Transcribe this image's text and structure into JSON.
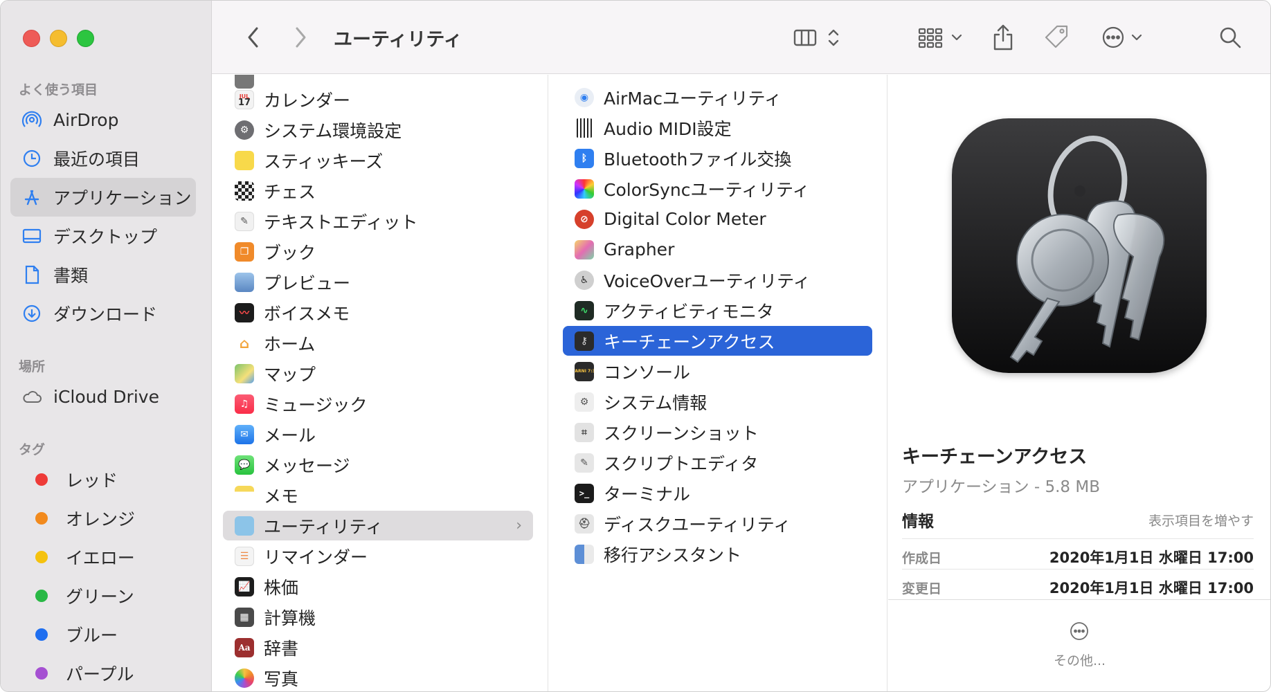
{
  "window": {
    "title": "ユーティリティ"
  },
  "sidebar": {
    "favorites_header": "よく使う項目",
    "favorites": [
      {
        "label": "AirDrop",
        "icon": "airdrop-icon"
      },
      {
        "label": "最近の項目",
        "icon": "clock-icon"
      },
      {
        "label": "アプリケーション",
        "icon": "applications-icon",
        "selected": true
      },
      {
        "label": "デスクトップ",
        "icon": "desktop-icon"
      },
      {
        "label": "書類",
        "icon": "document-icon"
      },
      {
        "label": "ダウンロード",
        "icon": "download-icon"
      }
    ],
    "locations_header": "場所",
    "locations": [
      {
        "label": "iCloud Drive",
        "icon": "cloud-icon"
      }
    ],
    "tags_header": "タグ",
    "tags": [
      {
        "label": "レッド",
        "color": "#ee3b38"
      },
      {
        "label": "オレンジ",
        "color": "#f28a1d"
      },
      {
        "label": "イエロー",
        "color": "#f5c20e"
      },
      {
        "label": "グリーン",
        "color": "#29b845"
      },
      {
        "label": "ブルー",
        "color": "#1f6ff0"
      },
      {
        "label": "パープル",
        "color": "#a550d2"
      }
    ]
  },
  "column1": {
    "items": [
      {
        "label": "カレンダー",
        "color": "#f3f3f3"
      },
      {
        "label": "システム環境設定",
        "color": "#6e6e72"
      },
      {
        "label": "スティッキーズ",
        "color": "#f8d94a"
      },
      {
        "label": "チェス",
        "color": "#444444"
      },
      {
        "label": "テキストエディット",
        "color": "#e9e9e9"
      },
      {
        "label": "ブック",
        "color": "#f08a2a"
      },
      {
        "label": "プレビュー",
        "color": "#7aa7d9"
      },
      {
        "label": "ボイスメモ",
        "color": "#1c1c1c"
      },
      {
        "label": "ホーム",
        "color": "#f2a43a"
      },
      {
        "label": "マップ",
        "color": "#7cc36b"
      },
      {
        "label": "ミュージック",
        "color": "#fa3c4f"
      },
      {
        "label": "メール",
        "color": "#3a8ef0"
      },
      {
        "label": "メッセージ",
        "color": "#3ccf4e"
      },
      {
        "label": "メモ",
        "color": "#f6d859"
      },
      {
        "label": "ユーティリティ",
        "color": "#8cc4e8",
        "parent": true
      },
      {
        "label": "リマインダー",
        "color": "#f4f4f4"
      },
      {
        "label": "株価",
        "color": "#1d1d1d"
      },
      {
        "label": "計算機",
        "color": "#4a4a4a"
      },
      {
        "label": "辞書",
        "color": "#9c2f2f"
      },
      {
        "label": "写真",
        "color": "#f4f4f4"
      }
    ],
    "chevron": "›",
    "calendar_month": "JUL",
    "calendar_day": "17",
    "dictionary_glyph": "Aa"
  },
  "column2": {
    "items": [
      {
        "label": "AirMacユーティリティ",
        "color": "#e9eef5"
      },
      {
        "label": "Audio MIDI設定",
        "color": "#2a2a2a"
      },
      {
        "label": "Bluetoothファイル交換",
        "color": "#2f7ff0"
      },
      {
        "label": "ColorSyncユーティリティ",
        "color": "#e0e0e0"
      },
      {
        "label": "Digital Color Meter",
        "color": "#d6402b"
      },
      {
        "label": "Grapher",
        "color": "#d9d9d9"
      },
      {
        "label": "VoiceOverユーティリティ",
        "color": "#cfcfcf"
      },
      {
        "label": "アクティビティモニタ",
        "color": "#1f2b24"
      },
      {
        "label": "キーチェーンアクセス",
        "color": "#2b2b2b",
        "selected": true
      },
      {
        "label": "コンソール",
        "color": "#2a2a2a"
      },
      {
        "label": "システム情報",
        "color": "#eeeeee"
      },
      {
        "label": "スクリーンショット",
        "color": "#e2e2e2"
      },
      {
        "label": "スクリプトエディタ",
        "color": "#e6e6e6"
      },
      {
        "label": "ターミナル",
        "color": "#1b1b1b"
      },
      {
        "label": "ディスクユーティリティ",
        "color": "#e6e6e6"
      },
      {
        "label": "移行アシスタント",
        "color": "#5d8fd6"
      }
    ],
    "console_glyph": "WARNI 7:36",
    "terminal_glyph": ">_"
  },
  "preview": {
    "name": "キーチェーンアクセス",
    "subtitle": "アプリケーション - 5.8 MB",
    "info_header": "情報",
    "show_more": "表示項目を増やす",
    "created_label": "作成日",
    "created_value": "2020年1月1日 水曜日 17:00",
    "modified_label": "変更日",
    "modified_value": "2020年1月1日 水曜日 17:00",
    "others_label": "その他..."
  }
}
